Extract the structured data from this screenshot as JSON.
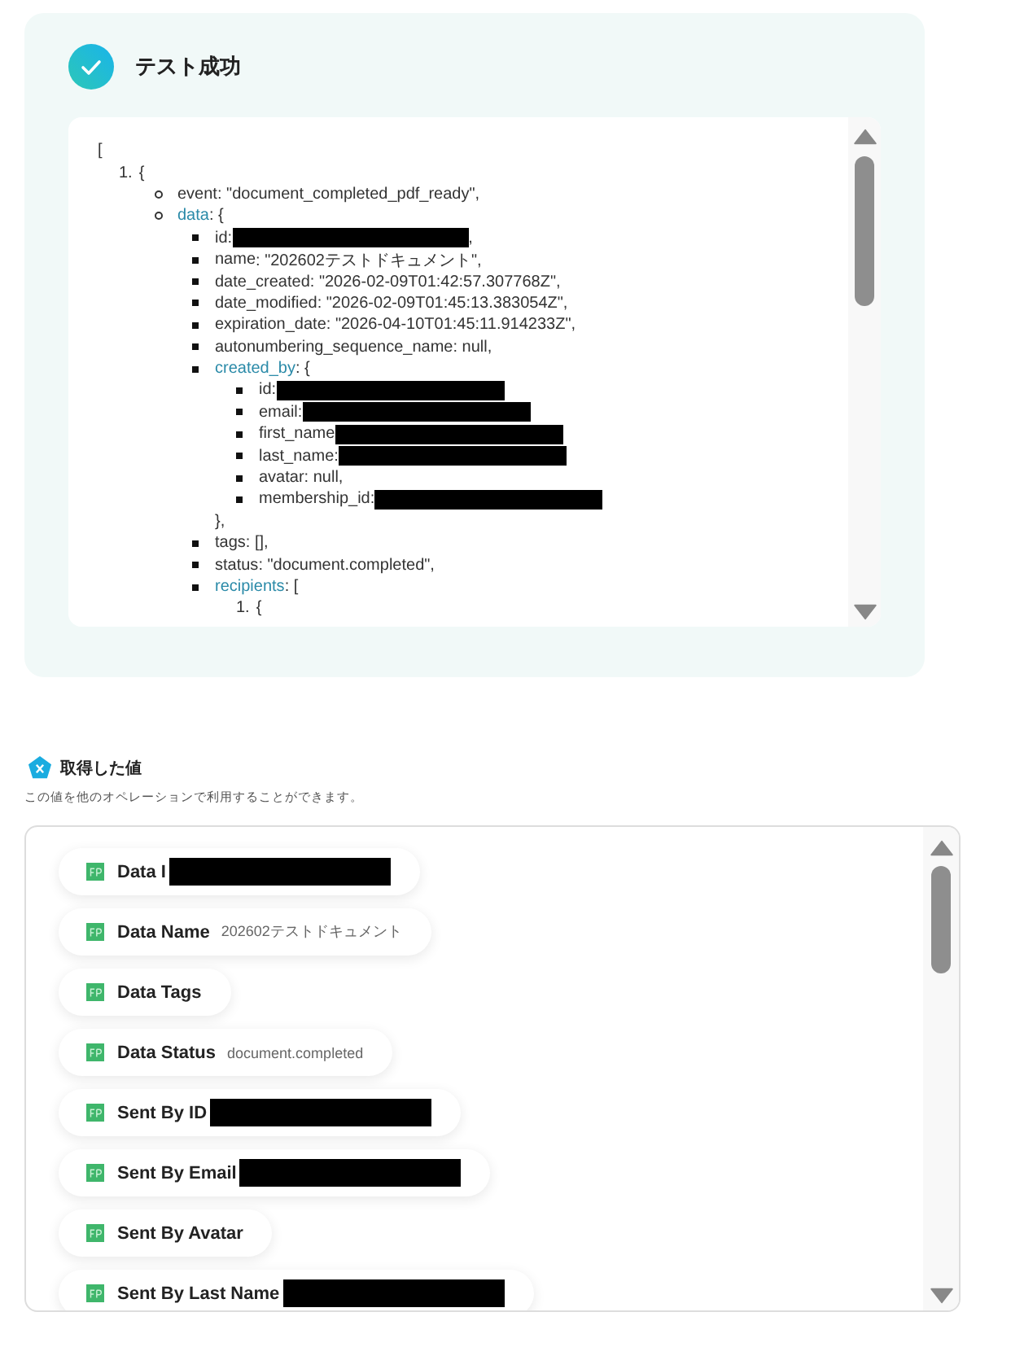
{
  "test_result": {
    "title": "テスト成功",
    "success": true,
    "code": [
      {
        "value": "["
      },
      {
        "marker": "1.",
        "value": "{",
        "children": [
          {
            "key": "event",
            "value": ": \"document_completed_pdf_ready\","
          },
          {
            "key": "data",
            "linked": true,
            "value": ": {",
            "children": [
              {
                "key": "id",
                "value": ": ",
                "redacted": true,
                "suffix": ","
              },
              {
                "key": "name",
                "value": ": \"202602テストドキュメント\","
              },
              {
                "key": "date_created",
                "value": ": \"2026-02-09T01:42:57.307768Z\","
              },
              {
                "key": "date_modified",
                "value": ": \"2026-02-09T01:45:13.383054Z\","
              },
              {
                "key": "expiration_date",
                "value": ": \"2026-04-10T01:45:11.914233Z\","
              },
              {
                "key": "autonumbering_sequence_name",
                "value": ": null,"
              },
              {
                "key": "created_by",
                "linked": true,
                "value": ": {",
                "close": "},",
                "children": [
                  {
                    "key": "id",
                    "value": ": ",
                    "redacted": true
                  },
                  {
                    "key": "email",
                    "value": ":",
                    "redacted": true
                  },
                  {
                    "key": "first_name",
                    "redacted": true
                  },
                  {
                    "key": "last_name",
                    "value": ":",
                    "redacted": true
                  },
                  {
                    "key": "avatar",
                    "value": ": null,"
                  },
                  {
                    "key": "membership_id",
                    "value": ": ",
                    "redacted": true
                  }
                ]
              },
              {
                "key": "tags",
                "value": ": [],"
              },
              {
                "key": "status",
                "value": ": \"document.completed\","
              },
              {
                "key": "recipients",
                "linked": true,
                "value": ": [",
                "children": [
                  {
                    "marker": "1.",
                    "value": "{"
                  }
                ]
              }
            ]
          }
        ]
      }
    ]
  },
  "obtained_values": {
    "title": "取得した値",
    "description": "この値を他のオペレーションで利用することができます。",
    "items": [
      {
        "label": "Data I",
        "redacted": true
      },
      {
        "label": "Data Name",
        "value": "202602テストドキュメント"
      },
      {
        "label": "Data Tags"
      },
      {
        "label": "Data Status",
        "value": "document.completed"
      },
      {
        "label": "Sent By ID",
        "redacted": true
      },
      {
        "label": "Sent By Email",
        "redacted": true
      },
      {
        "label": "Sent By Avatar"
      },
      {
        "label": "Sent By Last Name",
        "redacted": true
      }
    ]
  }
}
